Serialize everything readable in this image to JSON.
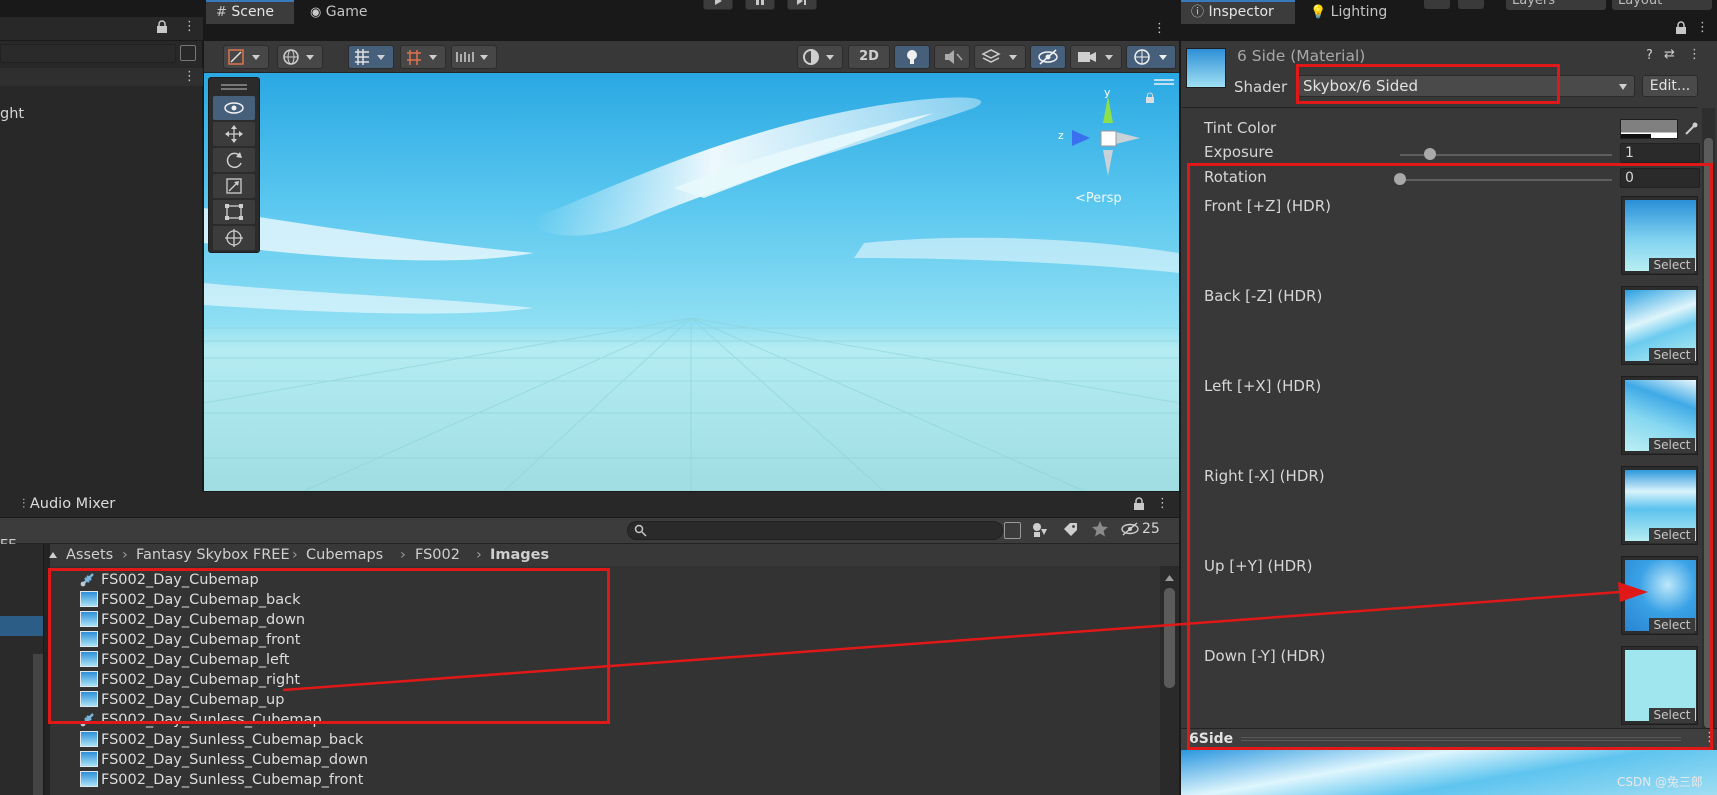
{
  "top_toolbar": {
    "layers_label": "Layers",
    "layout_label": "Layout"
  },
  "hierarchy": {
    "partial_item": "ght"
  },
  "scene": {
    "tabs": [
      {
        "label": "Scene"
      },
      {
        "label": "Game"
      }
    ],
    "btn_2d": "2D",
    "persp_label": "<Persp",
    "axis_y": "y",
    "axis_z": "z"
  },
  "audio_mixer": {
    "tab_label": "Audio Mixer"
  },
  "project": {
    "hidden_count": "25",
    "left_partial": "EE",
    "breadcrumb": [
      "Assets",
      "Fantasy Skybox FREE",
      "Cubemaps",
      "FS002",
      "Images"
    ],
    "files": [
      {
        "name": "FS002_Day_Cubemap",
        "icon": "cubemap-icon"
      },
      {
        "name": "FS002_Day_Cubemap_back",
        "icon": "texture-icon"
      },
      {
        "name": "FS002_Day_Cubemap_down",
        "icon": "texture-icon"
      },
      {
        "name": "FS002_Day_Cubemap_front",
        "icon": "texture-icon"
      },
      {
        "name": "FS002_Day_Cubemap_left",
        "icon": "texture-icon"
      },
      {
        "name": "FS002_Day_Cubemap_right",
        "icon": "texture-icon"
      },
      {
        "name": "FS002_Day_Cubemap_up",
        "icon": "texture-icon"
      },
      {
        "name": "FS002_Day_Sunless_Cubemap",
        "icon": "cubemap-icon"
      },
      {
        "name": "FS002_Day_Sunless_Cubemap_back",
        "icon": "texture-icon"
      },
      {
        "name": "FS002_Day_Sunless_Cubemap_down",
        "icon": "texture-icon"
      },
      {
        "name": "FS002_Day_Sunless_Cubemap_front",
        "icon": "texture-icon"
      }
    ]
  },
  "inspector": {
    "tabs": [
      {
        "label": "Inspector"
      },
      {
        "label": "Lighting"
      }
    ],
    "material_name": "6 Side (Material)",
    "shader_label": "Shader",
    "shader_value": "Skybox/6 Sided",
    "edit_button": "Edit...",
    "tint_label": "Tint Color",
    "exposure_label": "Exposure",
    "exposure_value": "1",
    "exposure_fraction": 0.14,
    "rotation_label": "Rotation",
    "rotation_value": "0",
    "rotation_fraction": 0.0,
    "texture_slots": [
      {
        "label": "Front [+Z]   (HDR)"
      },
      {
        "label": "Back [-Z]   (HDR)"
      },
      {
        "label": "Left [+X]   (HDR)"
      },
      {
        "label": "Right [-X]   (HDR)"
      },
      {
        "label": "Up [+Y]   (HDR)"
      },
      {
        "label": "Down [-Y]   (HDR)"
      }
    ],
    "select_label": "Select",
    "preview_title": "6Side"
  },
  "watermark": "CSDN @兔三郎",
  "colors": {
    "accent": "#3a79bb",
    "annotation_red": "#e01818",
    "panel": "#383838"
  }
}
